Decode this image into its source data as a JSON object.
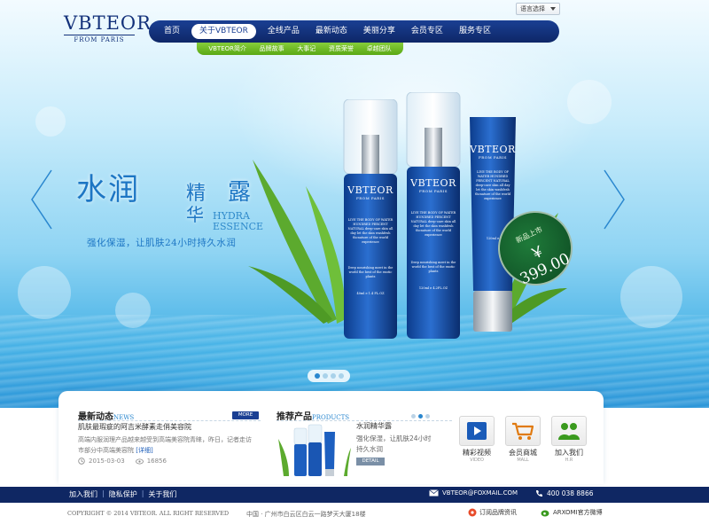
{
  "brand": {
    "logo_main": "VBTEOR",
    "logo_sub": "FROM PARIS"
  },
  "lang_select": {
    "label": "语言选择"
  },
  "nav": {
    "items": [
      "首页",
      "关于VBTEOR",
      "全线产品",
      "最新动态",
      "美丽分享",
      "会员专区",
      "服务专区"
    ],
    "active_index": 1
  },
  "subnav": {
    "items": [
      "VBTEOR简介",
      "品牌故事",
      "大事记",
      "资质荣誉",
      "卓越团队"
    ]
  },
  "hero": {
    "title_big": "水润",
    "title_char_1": "精",
    "title_char_2": "露",
    "title_char_3": "华",
    "title_en_1": "HYDRA",
    "title_en_2": "ESSENCE",
    "slogan": "强化保湿，让肌肤24小时持久水润",
    "products": [
      {
        "brand": "VBTEOR",
        "from": "FROM PARIS",
        "copy": "LIVE THE BODY OF WATER HUNDRED PERCENT NATURAL deep-care skin all day let the skin washfesh thcnature of the world experience",
        "bottom": "Deep nourishing meet in the world the best of the exotic plants",
        "size": "40ml e 1.4 FL.OZ"
      },
      {
        "brand": "VBTEOR",
        "from": "FROM PARIS",
        "copy": "LIVE THE BODY OF WATER HUNDRED PERCENT NATURAL deep-care skin all day let the skin washfesh thcnature of the world experience",
        "bottom": "Deep nourishing meet in the world the best of the exotic plants",
        "size": "120ml e 4.2FL.OZ"
      },
      {
        "brand": "VBTEOR",
        "from": "FROM PARIS",
        "copy": "LIVE THE BODY OF WATER HUNDRED PERCENT NATURAL deep-care skin all day let the skin washfesh thcnature of the world experience",
        "size": "120ml e"
      }
    ],
    "price_badge": {
      "tag": "新品上市",
      "price": "￥ 399.00"
    },
    "slider_dots": 4,
    "active_dot": 0,
    "accent_color": "#1d76c4"
  },
  "news": {
    "title": "最新动态",
    "title_en": "NEWS",
    "more_label": "MORE",
    "headline": "肌肤最瑕疵的阿吉米酵素走俏美容院",
    "body": "高端内服润理产品越来越受到高端美容院青睐，昨日，记者走访市部分中高端美容院",
    "detail_label": "[详细]",
    "date": "2015-03-03",
    "views": "16856"
  },
  "recommend": {
    "title": "推荐产品",
    "title_en": "PRODUCTS",
    "product_name": "水润精华露",
    "product_desc": "强化保湿，让肌肤24小时持久水润",
    "detail_label": "DETAIL",
    "mini_dots": 3,
    "active_mini_dot": 1
  },
  "tiles": [
    {
      "cn": "精彩视频",
      "en": "VIDEO",
      "icon": "video-icon",
      "color": "#1a5bb8"
    },
    {
      "cn": "会员商城",
      "en": "MALL",
      "icon": "cart-icon",
      "color": "#e07a10"
    },
    {
      "cn": "加入我们",
      "en": "H.R",
      "icon": "people-icon",
      "color": "#3a9a1e"
    }
  ],
  "footer": {
    "links": [
      "加入我们",
      "隐私保护",
      "关于我们"
    ],
    "separator": "|",
    "email": "VBTEOR@FOXMAIL.COM",
    "phone": "400 038 8866",
    "copyright": "COPYRIGHT © 2014 VBTEOR. ALL RIGHT RESERVED",
    "address": "中国 · 广州市白云区白云一路梦天大厦18楼",
    "weibo_label": "订阅品牌资讯",
    "wechat_label": "ARXOMI官方微博"
  }
}
